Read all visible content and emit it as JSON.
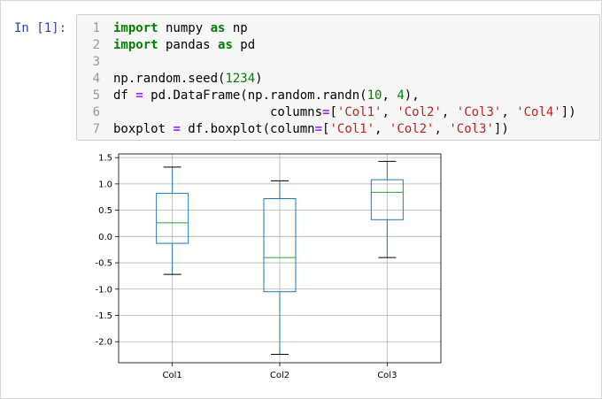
{
  "prompt": "In [1]:",
  "code_lines": [
    {
      "n": "1",
      "tokens": [
        {
          "t": "import",
          "c": "kw"
        },
        {
          "t": " numpy ",
          "c": ""
        },
        {
          "t": "as",
          "c": "kw"
        },
        {
          "t": " np",
          "c": ""
        }
      ]
    },
    {
      "n": "2",
      "tokens": [
        {
          "t": "import",
          "c": "kw"
        },
        {
          "t": " pandas ",
          "c": ""
        },
        {
          "t": "as",
          "c": "kw"
        },
        {
          "t": " pd",
          "c": ""
        }
      ]
    },
    {
      "n": "3",
      "tokens": []
    },
    {
      "n": "4",
      "tokens": [
        {
          "t": "np.random.seed(",
          "c": ""
        },
        {
          "t": "1234",
          "c": "num"
        },
        {
          "t": ")",
          "c": ""
        }
      ]
    },
    {
      "n": "5",
      "tokens": [
        {
          "t": "df ",
          "c": ""
        },
        {
          "t": "=",
          "c": "op"
        },
        {
          "t": " pd.DataFrame(np.random.randn(",
          "c": ""
        },
        {
          "t": "10",
          "c": "num"
        },
        {
          "t": ", ",
          "c": ""
        },
        {
          "t": "4",
          "c": "num"
        },
        {
          "t": "),",
          "c": ""
        }
      ]
    },
    {
      "n": "6",
      "tokens": [
        {
          "t": "                     columns",
          "c": ""
        },
        {
          "t": "=",
          "c": "op"
        },
        {
          "t": "[",
          "c": ""
        },
        {
          "t": "'Col1'",
          "c": "str"
        },
        {
          "t": ", ",
          "c": ""
        },
        {
          "t": "'Col2'",
          "c": "str"
        },
        {
          "t": ", ",
          "c": ""
        },
        {
          "t": "'Col3'",
          "c": "str"
        },
        {
          "t": ", ",
          "c": ""
        },
        {
          "t": "'Col4'",
          "c": "str"
        },
        {
          "t": "])",
          "c": ""
        }
      ]
    },
    {
      "n": "7",
      "tokens": [
        {
          "t": "boxplot ",
          "c": ""
        },
        {
          "t": "=",
          "c": "op"
        },
        {
          "t": " df.boxplot(column",
          "c": ""
        },
        {
          "t": "=",
          "c": "op"
        },
        {
          "t": "[",
          "c": ""
        },
        {
          "t": "'Col1'",
          "c": "str"
        },
        {
          "t": ", ",
          "c": ""
        },
        {
          "t": "'Col2'",
          "c": "str"
        },
        {
          "t": ", ",
          "c": ""
        },
        {
          "t": "'Col3'",
          "c": "str"
        },
        {
          "t": "])",
          "c": ""
        }
      ]
    }
  ],
  "chart_data": {
    "type": "box",
    "categories": [
      "Col1",
      "Col2",
      "Col3"
    ],
    "boxes": [
      {
        "name": "Col1",
        "whislo": -0.72,
        "q1": -0.13,
        "med": 0.26,
        "q3": 0.82,
        "whishi": 1.32
      },
      {
        "name": "Col2",
        "whislo": -2.24,
        "q1": -1.05,
        "med": -0.4,
        "q3": 0.72,
        "whishi": 1.06
      },
      {
        "name": "Col3",
        "whislo": -0.4,
        "q1": 0.32,
        "med": 0.84,
        "q3": 1.08,
        "whishi": 1.43
      }
    ],
    "yticks": [
      "-2.0",
      "-1.5",
      "-1.0",
      "-0.5",
      "0.0",
      "0.5",
      "1.0",
      "1.5"
    ],
    "ylim": [
      -2.4,
      1.57
    ],
    "grid": true,
    "colors": {
      "box": "#1f77b4",
      "median": "#2ca02c",
      "whisker": "#000000",
      "grid": "#b0b0b0"
    }
  }
}
